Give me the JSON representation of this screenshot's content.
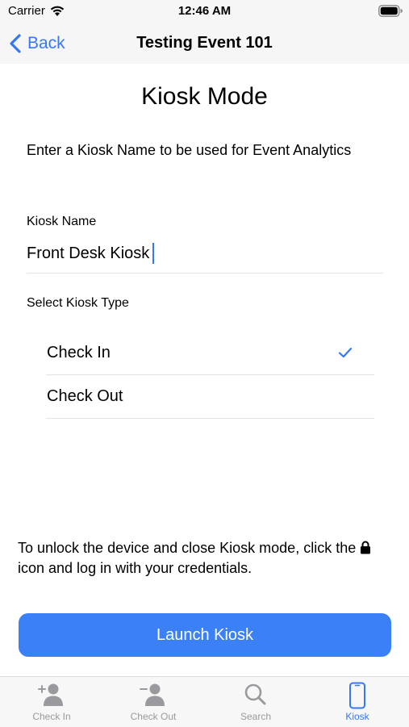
{
  "status_bar": {
    "carrier": "Carrier",
    "time": "12:46 AM"
  },
  "nav": {
    "back_label": "Back",
    "title": "Testing Event 101"
  },
  "page": {
    "title": "Kiosk Mode",
    "instructions": "Enter a Kiosk Name to be used for Event Analytics"
  },
  "kiosk_name": {
    "label": "Kiosk Name",
    "value": "Front Desk Kiosk"
  },
  "kiosk_type": {
    "label": "Select Kiosk Type",
    "options": [
      {
        "label": "Check In",
        "selected": true
      },
      {
        "label": "Check Out",
        "selected": false
      }
    ]
  },
  "unlock_note": {
    "before_icon": "To unlock the device and close Kiosk mode, click the",
    "icon": "lock-icon",
    "after_icon": "icon and log in with your credentials."
  },
  "launch_button": {
    "label": "Launch Kiosk"
  },
  "tab_bar": {
    "tabs": [
      {
        "label": "Check In",
        "icon": "person-add-icon",
        "active": false
      },
      {
        "label": "Check Out",
        "icon": "person-remove-icon",
        "active": false
      },
      {
        "label": "Search",
        "icon": "search-icon",
        "active": false
      },
      {
        "label": "Kiosk",
        "icon": "phone-icon",
        "active": true
      }
    ]
  },
  "colors": {
    "accent": "#3478f6",
    "button": "#3b80f7",
    "inactive_tab": "#9a9a9e",
    "bar_background": "#f6f6f6"
  }
}
